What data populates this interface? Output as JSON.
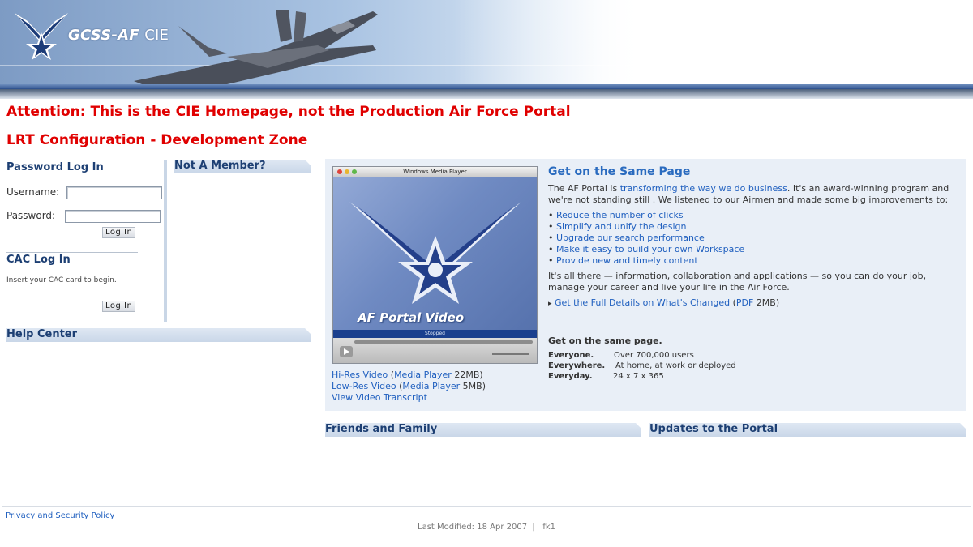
{
  "banner": {
    "logo_text_main": "GCSS-AF",
    "logo_text_suffix": "CIE"
  },
  "attention": {
    "line1": "Attention: This is the CIE Homepage, not the Production Air Force Portal",
    "line2": "LRT Configuration - Development Zone"
  },
  "login": {
    "title": "Password Log In",
    "username_label": "Username:",
    "password_label": "Password:",
    "username_value": "",
    "password_value": "",
    "login_button": "Log In",
    "cac_title": "CAC Log In",
    "cac_hint": "Insert your CAC card to begin.",
    "cac_button": "Log In"
  },
  "member": {
    "title": "Not A Member?"
  },
  "help": {
    "title": "Help Center"
  },
  "video": {
    "player_title": "Windows Media Player",
    "caption": "AF Portal Video",
    "status": "Stopped",
    "hires_link": "Hi-Res Video",
    "hires_player": "Media Player",
    "hires_size": "22MB)",
    "lowres_link": "Low-Res Video",
    "lowres_player": "Media Player",
    "lowres_size": "5MB)",
    "transcript_link": "View Video Transcript"
  },
  "feature": {
    "title": "Get on the Same Page",
    "intro_pre": "The AF Portal is ",
    "intro_link": "transforming the way we do business",
    "intro_post": ". It's an award-winning program and we're not standing still . We listened to our Airmen and made some big improvements to:",
    "bullets": [
      "Reduce the number of clicks",
      "Simplify and unify the design",
      "Upgrade our search performance",
      "Make it easy to build your own Workspace",
      "Provide new and timely content"
    ],
    "summary": "It's all there — information, collaboration and applications — so you can do your job, manage your career and live your life in the Air Force.",
    "details_link": "Get the Full Details on What's Changed",
    "pdf_link": "PDF",
    "pdf_size": "2MB)",
    "same_page_2": "Get on the same page.",
    "stats": [
      {
        "label": "Everyone.",
        "value": "Over 700,000 users"
      },
      {
        "label": "Everywhere.",
        "value": "At home, at work or deployed"
      },
      {
        "label": "Everyday.",
        "value": "24 x 7 x 365"
      }
    ]
  },
  "friends": {
    "title": "Friends and Family"
  },
  "updates": {
    "title": "Updates to the Portal"
  },
  "footer": {
    "privacy": "Privacy and Security Policy",
    "modified": "Last Modified: 18 Apr 2007  |   fk1"
  }
}
